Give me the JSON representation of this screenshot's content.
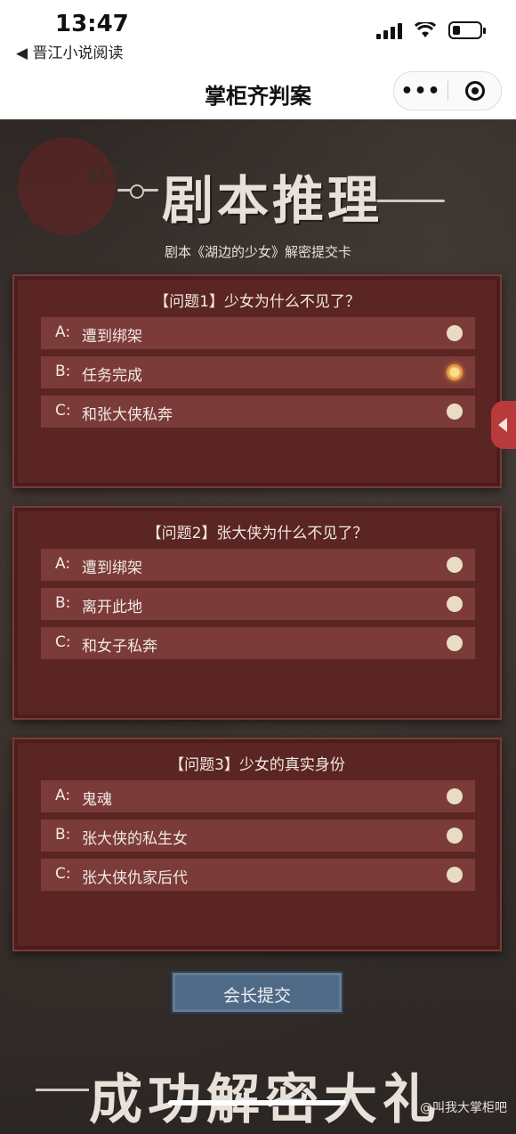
{
  "status": {
    "time": "13:47",
    "back_app": "◀ 晋江小说阅读"
  },
  "nav": {
    "title": "掌柜齐判案",
    "more": "•••"
  },
  "header": {
    "episode": "02",
    "title": "剧本推理",
    "subtitle": "剧本《湖边的少女》解密提交卡"
  },
  "questions": [
    {
      "title": "【问题1】少女为什么不见了？",
      "options": [
        {
          "letter": "A:",
          "text": "遭到绑架",
          "selected": false
        },
        {
          "letter": "B:",
          "text": "任务完成",
          "selected": true
        },
        {
          "letter": "C:",
          "text": "和张大侠私奔",
          "selected": false
        }
      ]
    },
    {
      "title": "【问题2】张大侠为什么不见了？",
      "options": [
        {
          "letter": "A:",
          "text": "遭到绑架",
          "selected": false
        },
        {
          "letter": "B:",
          "text": "离开此地",
          "selected": false
        },
        {
          "letter": "C:",
          "text": "和女子私奔",
          "selected": false
        }
      ]
    },
    {
      "title": "【问题3】少女的真实身份",
      "options": [
        {
          "letter": "A:",
          "text": "鬼魂",
          "selected": false
        },
        {
          "letter": "B:",
          "text": "张大侠的私生女",
          "selected": false
        },
        {
          "letter": "C:",
          "text": "张大侠仇家后代",
          "selected": false
        }
      ]
    }
  ],
  "submit_label": "会长提交",
  "footer_title": "成功解密大礼",
  "credit": "@叫我大掌柜吧",
  "colors": {
    "card": "#5b2523",
    "option": "#7b3b39",
    "submit": "#4e6a86",
    "selected_radio": "#e88a3a"
  }
}
